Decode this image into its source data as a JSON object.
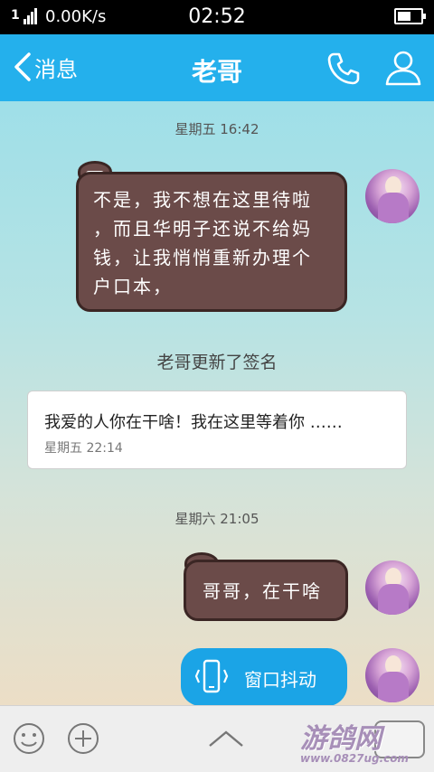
{
  "status_bar": {
    "sim_label": "1",
    "network_speed": "0.00K/s",
    "time": "02:52",
    "battery_level": 0.6
  },
  "nav": {
    "back_label": "消息",
    "title": "老哥",
    "phone_icon": "phone-icon",
    "contact_icon": "person-icon"
  },
  "chat": {
    "timestamp_1": "星期五 16:42",
    "message_1_lines": [
      "不是，我不想在这里待啦",
      "，而且华明子还说不给妈",
      "钱，让我悄悄重新办理个",
      "户口本，"
    ],
    "system_note": "老哥更新了签名",
    "signature": {
      "text": "我爱的人你在干啥！我在这里等着你 ……",
      "time": "星期五 22:14"
    },
    "timestamp_2": "星期六 21:05",
    "message_2": "哥哥，在干啥",
    "shake_label": "窗口抖动"
  },
  "input_bar": {
    "emoji_icon": "emoji-icon",
    "plus_icon": "plus-icon",
    "expand_icon": "chevron-up-icon",
    "voice_icon": "voice-input-icon"
  },
  "watermark": {
    "main": "游鸽网",
    "sub": "www.0827ug.com"
  },
  "colors": {
    "navbar": "#24b0ec",
    "bubble": "#6b4b49",
    "shake_bubble": "#1ba4e6"
  }
}
